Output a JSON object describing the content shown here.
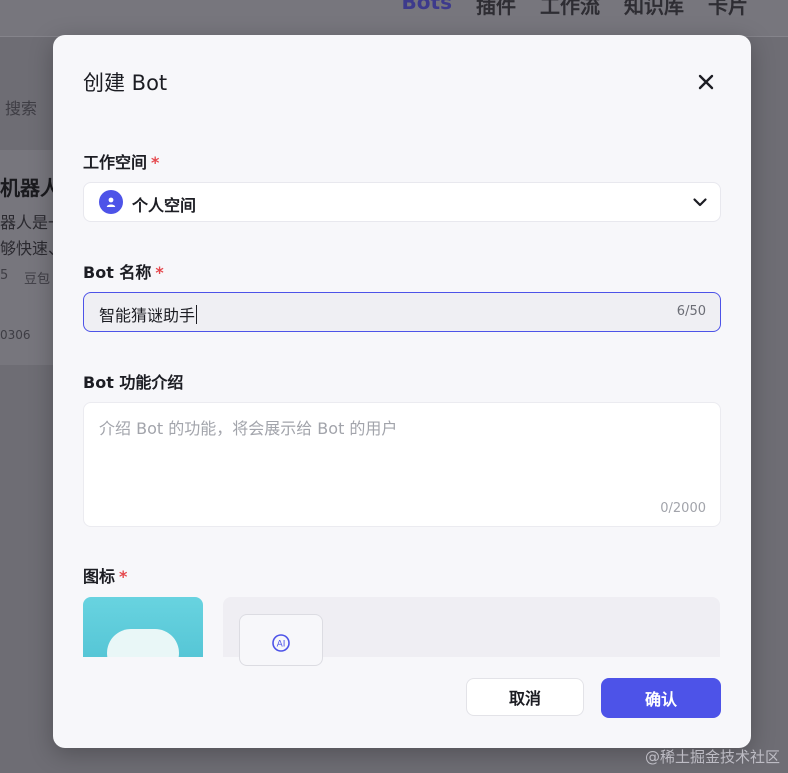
{
  "background": {
    "nav": [
      "Bots",
      "插件",
      "工作流",
      "知识库",
      "卡片"
    ],
    "search_label": "搜索",
    "card": {
      "title": "机器人",
      "desc_line1": "器人是一",
      "desc_line2": "够快速、",
      "meta_left": "5",
      "meta_right": "豆包",
      "number": "0306"
    }
  },
  "modal": {
    "title": "创建 Bot",
    "close_icon": "close-icon",
    "workspace": {
      "label": "工作空间",
      "required_mark": "*",
      "value": "个人空间",
      "icon": "user-icon"
    },
    "bot_name": {
      "label": "Bot 名称",
      "required_mark": "*",
      "value": "智能猜谜助手",
      "count": "6/50"
    },
    "bot_description": {
      "label": "Bot 功能介绍",
      "placeholder": "介绍 Bot 的功能，将会展示给 Bot 的用户",
      "count": "0/2000"
    },
    "icon_field": {
      "label": "图标",
      "required_mark": "*",
      "ai_button_icon": "ai-generate-icon"
    },
    "buttons": {
      "cancel": "取消",
      "confirm": "确认"
    }
  },
  "watermark": "@稀土掘金技术社区",
  "colors": {
    "accent": "#4d53e8",
    "required": "#e5484d",
    "overlay": "#6e6d74"
  }
}
